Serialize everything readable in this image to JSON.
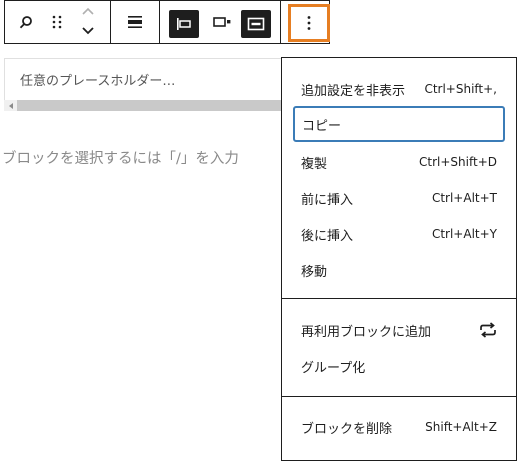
{
  "toolbar": {
    "buttons": [
      {
        "name": "block-icon",
        "interactable": true
      },
      {
        "name": "drag-handle-icon",
        "interactable": true
      },
      {
        "name": "move-up-icon",
        "interactable": true
      },
      {
        "name": "move-down-icon",
        "interactable": true
      },
      {
        "name": "align-icon",
        "interactable": true
      },
      {
        "name": "justify-left-icon",
        "interactable": true
      },
      {
        "name": "justify-center-icon",
        "interactable": true
      },
      {
        "name": "justify-space-icon",
        "interactable": true
      },
      {
        "name": "more-options-icon",
        "interactable": true
      }
    ],
    "highlight_color": "#e67e22"
  },
  "editor": {
    "placeholder": "任意のプレースホルダー…",
    "block_prompt": "ブロックを選択するには「/」を入力"
  },
  "menu": {
    "sections": [
      {
        "items": [
          {
            "label": "追加設定を非表示",
            "shortcut": "Ctrl+Shift+,"
          },
          {
            "label": "コピー",
            "shortcut": "",
            "focused": true
          },
          {
            "label": "複製",
            "shortcut": "Ctrl+Shift+D"
          },
          {
            "label": "前に挿入",
            "shortcut": "Ctrl+Alt+T"
          },
          {
            "label": "後に挿入",
            "shortcut": "Ctrl+Alt+Y"
          },
          {
            "label": "移動",
            "shortcut": ""
          }
        ]
      },
      {
        "items": [
          {
            "label": "再利用ブロックに追加",
            "icon": "reusable-block-icon"
          },
          {
            "label": "グループ化",
            "shortcut": ""
          }
        ]
      },
      {
        "items": [
          {
            "label": "ブロックを削除",
            "shortcut": "Shift+Alt+Z"
          }
        ]
      }
    ],
    "focus_color": "#3b7cb7"
  }
}
